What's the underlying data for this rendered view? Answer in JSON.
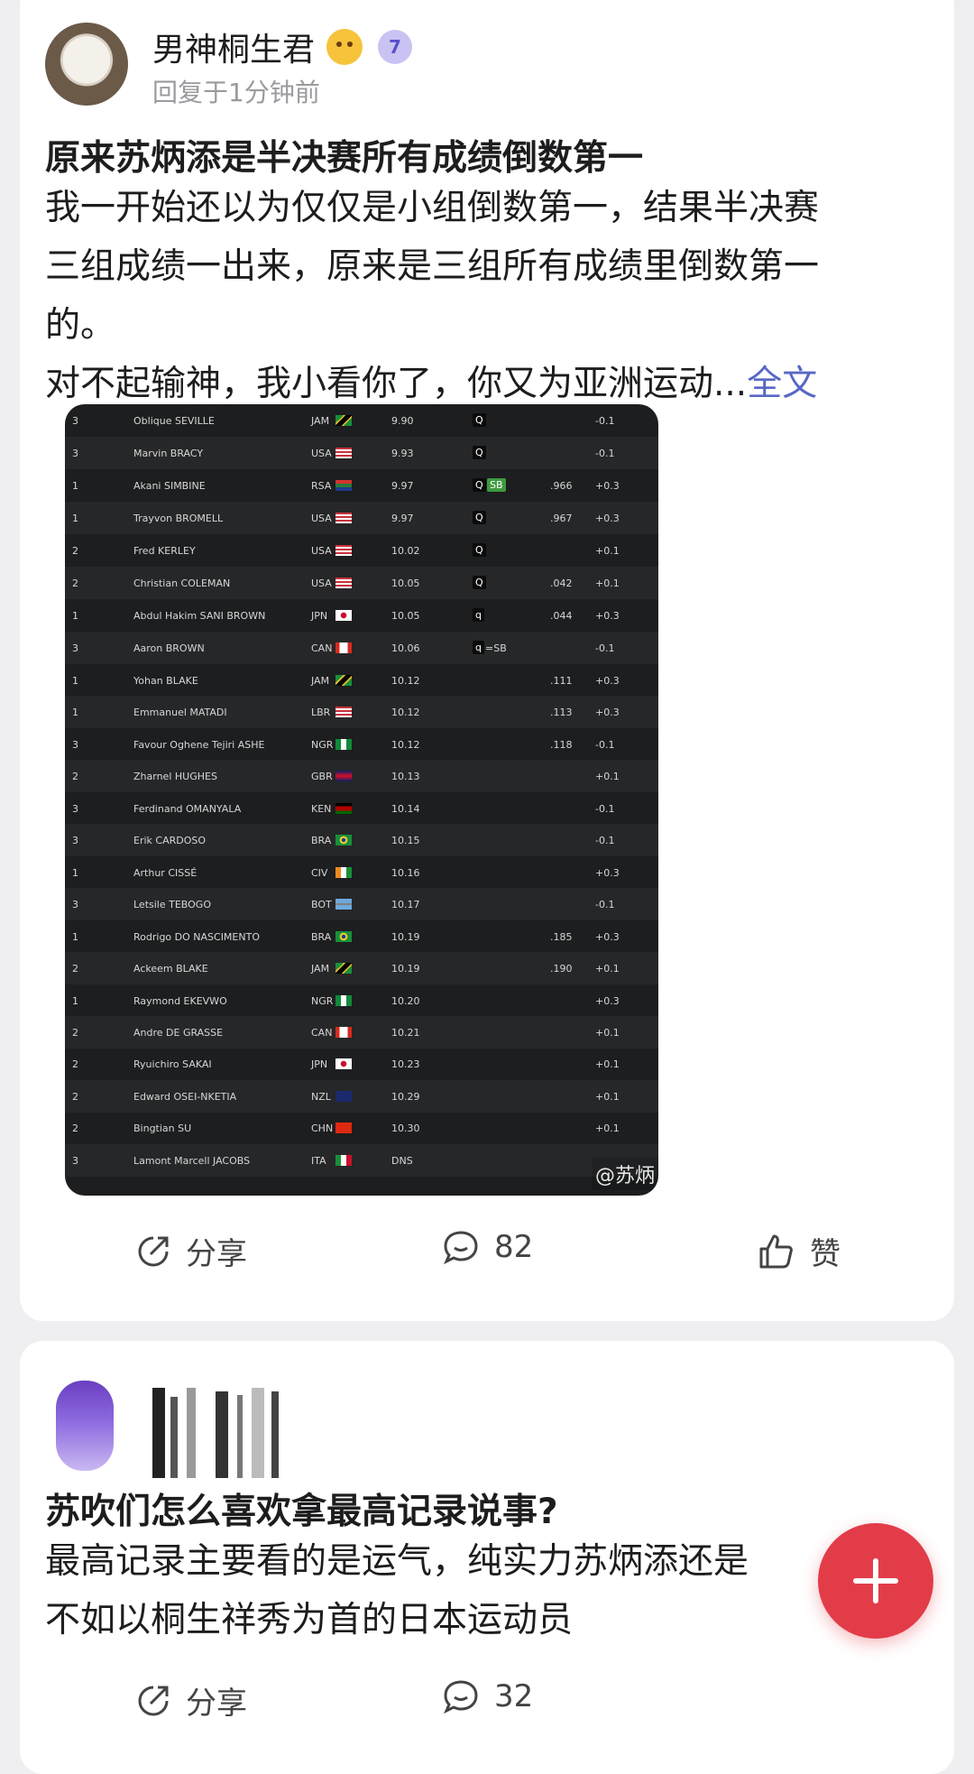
{
  "post": {
    "author": "男神桐生君",
    "level_badge": "7",
    "meta": "回复于1分钟前",
    "title": "原来苏炳添是半决赛所有成绩倒数第一",
    "body_lines": [
      "我一开始还以为仅仅是小组倒数第一，结果半决赛",
      "三组成绩一出来，原来是三组所有成绩里倒数第一",
      "的。",
      "对不起输神，我小看你了，你又为亚洲运动..."
    ],
    "full_text_link": "全文",
    "watermark": "@苏炳",
    "results": [
      {
        "heat": "3",
        "name": "Oblique SEVILLE",
        "nat": "JAM",
        "time": "9.90",
        "q": "Q",
        "note": "",
        "rt": "",
        "wind": "-0.1"
      },
      {
        "heat": "3",
        "name": "Marvin BRACY",
        "nat": "USA",
        "time": "9.93",
        "q": "Q",
        "note": "",
        "rt": "",
        "wind": "-0.1"
      },
      {
        "heat": "1",
        "name": "Akani SIMBINE",
        "nat": "RSA",
        "time": "9.97",
        "q": "Q",
        "note": "SB",
        "rt": ".966",
        "wind": "+0.3"
      },
      {
        "heat": "1",
        "name": "Trayvon BROMELL",
        "nat": "USA",
        "time": "9.97",
        "q": "Q",
        "note": "",
        "rt": ".967",
        "wind": "+0.3"
      },
      {
        "heat": "2",
        "name": "Fred KERLEY",
        "nat": "USA",
        "time": "10.02",
        "q": "Q",
        "note": "",
        "rt": "",
        "wind": "+0.1"
      },
      {
        "heat": "2",
        "name": "Christian COLEMAN",
        "nat": "USA",
        "time": "10.05",
        "q": "Q",
        "note": "",
        "rt": ".042",
        "wind": "+0.1"
      },
      {
        "heat": "1",
        "name": "Abdul Hakim SANI BROWN",
        "nat": "JPN",
        "time": "10.05",
        "q": "q",
        "note": "",
        "rt": ".044",
        "wind": "+0.3"
      },
      {
        "heat": "3",
        "name": "Aaron BROWN",
        "nat": "CAN",
        "time": "10.06",
        "q": "q",
        "note": "=SB",
        "rt": "",
        "wind": "-0.1"
      },
      {
        "heat": "1",
        "name": "Yohan BLAKE",
        "nat": "JAM",
        "time": "10.12",
        "q": "",
        "note": "",
        "rt": ".111",
        "wind": "+0.3"
      },
      {
        "heat": "1",
        "name": "Emmanuel MATADI",
        "nat": "LBR",
        "time": "10.12",
        "q": "",
        "note": "",
        "rt": ".113",
        "wind": "+0.3"
      },
      {
        "heat": "3",
        "name": "Favour Oghene Tejiri ASHE",
        "nat": "NGR",
        "time": "10.12",
        "q": "",
        "note": "",
        "rt": ".118",
        "wind": "-0.1"
      },
      {
        "heat": "2",
        "name": "Zharnel HUGHES",
        "nat": "GBR",
        "time": "10.13",
        "q": "",
        "note": "",
        "rt": "",
        "wind": "+0.1"
      },
      {
        "heat": "3",
        "name": "Ferdinand OMANYALA",
        "nat": "KEN",
        "time": "10.14",
        "q": "",
        "note": "",
        "rt": "",
        "wind": "-0.1"
      },
      {
        "heat": "3",
        "name": "Erik CARDOSO",
        "nat": "BRA",
        "time": "10.15",
        "q": "",
        "note": "",
        "rt": "",
        "wind": "-0.1"
      },
      {
        "heat": "1",
        "name": "Arthur CISSÉ",
        "nat": "CIV",
        "time": "10.16",
        "q": "",
        "note": "",
        "rt": "",
        "wind": "+0.3"
      },
      {
        "heat": "3",
        "name": "Letsile TEBOGO",
        "nat": "BOT",
        "time": "10.17",
        "q": "",
        "note": "",
        "rt": "",
        "wind": "-0.1"
      },
      {
        "heat": "1",
        "name": "Rodrigo DO NASCIMENTO",
        "nat": "BRA",
        "time": "10.19",
        "q": "",
        "note": "",
        "rt": ".185",
        "wind": "+0.3"
      },
      {
        "heat": "2",
        "name": "Ackeem BLAKE",
        "nat": "JAM",
        "time": "10.19",
        "q": "",
        "note": "",
        "rt": ".190",
        "wind": "+0.1"
      },
      {
        "heat": "1",
        "name": "Raymond EKEVWO",
        "nat": "NGR",
        "time": "10.20",
        "q": "",
        "note": "",
        "rt": "",
        "wind": "+0.3"
      },
      {
        "heat": "2",
        "name": "Andre DE GRASSE",
        "nat": "CAN",
        "time": "10.21",
        "q": "",
        "note": "",
        "rt": "",
        "wind": "+0.1"
      },
      {
        "heat": "2",
        "name": "Ryuichiro SAKAI",
        "nat": "JPN",
        "time": "10.23",
        "q": "",
        "note": "",
        "rt": "",
        "wind": "+0.1"
      },
      {
        "heat": "2",
        "name": "Edward OSEI-NKETIA",
        "nat": "NZL",
        "time": "10.29",
        "q": "",
        "note": "",
        "rt": "",
        "wind": "+0.1"
      },
      {
        "heat": "2",
        "name": "Bingtian SU",
        "nat": "CHN",
        "time": "10.30",
        "q": "",
        "note": "",
        "rt": "",
        "wind": "+0.1"
      },
      {
        "heat": "3",
        "name": "Lamont Marcell JACOBS",
        "nat": "ITA",
        "time": "DNS",
        "q": "",
        "note": "",
        "rt": "",
        "wind": ""
      }
    ],
    "actions": {
      "share": "分享",
      "comments": "82",
      "like": "赞"
    }
  },
  "post2": {
    "title": "苏吹们怎么喜欢拿最高记录说事?",
    "body_lines": [
      "最高记录主要看的是运气，纯实力苏炳添还是",
      "不如以桐生祥秀为首的日本运动员"
    ],
    "actions": {
      "share": "分享",
      "comments": "32"
    }
  },
  "fab_icon": "plus-icon",
  "colors": {
    "link": "#5867c6",
    "fab": "#e23c48",
    "sb_badge": "#3e9b3e"
  }
}
